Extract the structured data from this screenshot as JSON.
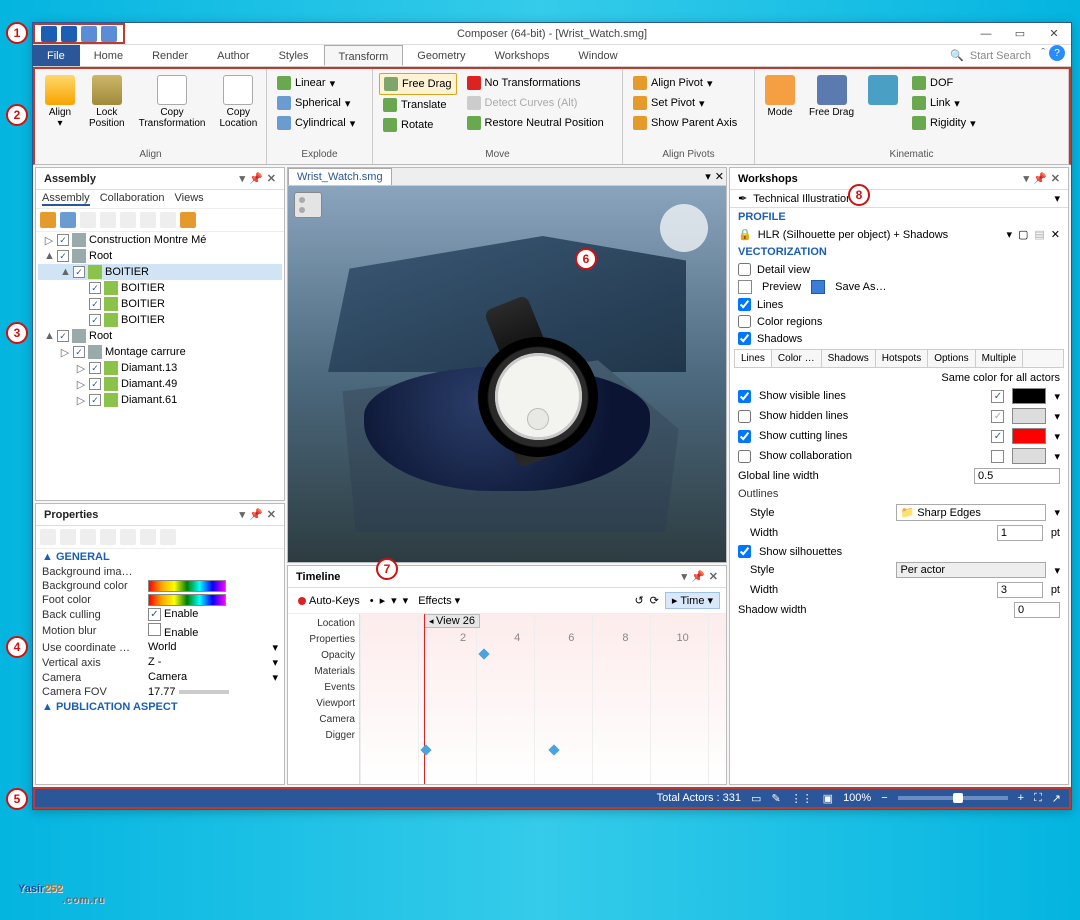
{
  "window_title": "Composer (64-bit) - [Wrist_Watch.smg]",
  "menu_tabs": [
    "File",
    "Home",
    "Render",
    "Author",
    "Styles",
    "Transform",
    "Geometry",
    "Workshops",
    "Window"
  ],
  "active_menu_tab": "Transform",
  "search_placeholder": "Start Search",
  "ribbon": {
    "align_group": "Align",
    "align_btn": "Align",
    "lock_btn": "Lock Position",
    "copy_trans": "Copy Transformation",
    "copy_loc": "Copy Location",
    "explode_group": "Explode",
    "explode_linear": "Linear",
    "explode_spherical": "Spherical",
    "explode_cyl": "Cylindrical",
    "move_group": "Move",
    "free_drag": "Free Drag",
    "translate": "Translate",
    "rotate": "Rotate",
    "no_trans": "No Transformations",
    "detect_curves": "Detect Curves (Alt)",
    "restore": "Restore Neutral Position",
    "pivots_group": "Align Pivots",
    "align_pivot": "Align Pivot",
    "set_pivot": "Set Pivot",
    "show_parent": "Show Parent Axis",
    "kine_group": "Kinematic",
    "mode": "Mode",
    "kine_free": "Free Drag",
    "dof": "DOF",
    "link": "Link",
    "rigidity": "Rigidity"
  },
  "assembly": {
    "title": "Assembly",
    "tabs": [
      "Assembly",
      "Collaboration",
      "Views"
    ],
    "tree": [
      {
        "indent": 0,
        "tw": "▷",
        "cb": true,
        "label": "Construction Montre Mé"
      },
      {
        "indent": 0,
        "tw": "▲",
        "cb": true,
        "label": "Root",
        "sel": false
      },
      {
        "indent": 1,
        "tw": "▲",
        "cb": true,
        "label": "BOITIER",
        "sel": true,
        "gear": true
      },
      {
        "indent": 2,
        "tw": "",
        "cb": true,
        "label": "BOITIER",
        "gear": true
      },
      {
        "indent": 2,
        "tw": "",
        "cb": true,
        "label": "BOITIER",
        "gear": true
      },
      {
        "indent": 2,
        "tw": "",
        "cb": true,
        "label": "BOITIER",
        "gear": true
      },
      {
        "indent": 0,
        "tw": "▲",
        "cb": true,
        "label": "Root"
      },
      {
        "indent": 1,
        "tw": "▷",
        "cb": true,
        "label": "Montage carrure"
      },
      {
        "indent": 2,
        "tw": "▷",
        "cb": true,
        "label": "Diamant.13",
        "gear": true
      },
      {
        "indent": 2,
        "tw": "▷",
        "cb": true,
        "label": "Diamant.49",
        "gear": true
      },
      {
        "indent": 2,
        "tw": "▷",
        "cb": true,
        "label": "Diamant.61",
        "gear": true
      }
    ]
  },
  "properties": {
    "title": "Properties",
    "section1": "GENERAL",
    "rows": [
      {
        "k": "Background ima…",
        "v": ""
      },
      {
        "k": "Background color",
        "v": "",
        "swatch": true
      },
      {
        "k": "Foot color",
        "v": "",
        "swatch": true
      },
      {
        "k": "Back culling",
        "v": "Enable",
        "check": true,
        "checked": true
      },
      {
        "k": "Motion blur",
        "v": "Enable",
        "check": true,
        "checked": false
      },
      {
        "k": "Use coordinate …",
        "v": "World",
        "dd": true
      },
      {
        "k": "Vertical axis",
        "v": "Z -",
        "dd": true
      },
      {
        "k": "Camera",
        "v": "Camera",
        "dd": true
      },
      {
        "k": "Camera FOV",
        "v": "17.77",
        "slider": true
      }
    ],
    "section2": "PUBLICATION ASPECT"
  },
  "viewport_tab": "Wrist_Watch.smg",
  "timeline": {
    "title": "Timeline",
    "auto_keys": "Auto-Keys",
    "effects": "Effects",
    "time": "Time",
    "view_marker": "View 26",
    "ticks": [
      "2",
      "4",
      "6",
      "8",
      "10"
    ],
    "tracks": [
      "Location",
      "Properties",
      "Opacity",
      "Materials",
      "Events",
      "Viewport",
      "Camera",
      "Digger"
    ]
  },
  "workshops": {
    "title": "Workshops",
    "subtitle": "Technical Illustration",
    "profile": "PROFILE",
    "profile_value": "HLR (Silhouette per object) + Shadows",
    "vector": "VECTORIZATION",
    "detail_view": "Detail view",
    "preview": "Preview",
    "saveas": "Save As…",
    "opt_lines": "Lines",
    "opt_color": "Color regions",
    "opt_shadows": "Shadows",
    "tabs": [
      "Lines",
      "Color …",
      "Shadows",
      "Hotspots",
      "Options",
      "Multiple"
    ],
    "same_color": "Same color for all actors",
    "show_visible": "Show visible lines",
    "show_hidden": "Show hidden lines",
    "show_cutting": "Show cutting lines",
    "show_collab": "Show collaboration",
    "glw": "Global line width",
    "glw_v": "0.5",
    "outlines": "Outlines",
    "style": "Style",
    "style_v": "Sharp Edges",
    "width": "Width",
    "width_v": "1",
    "pt": "pt",
    "show_sil": "Show silhouettes",
    "sil_style_v": "Per actor",
    "sil_width_v": "3",
    "shadow_w": "Shadow width",
    "shadow_w_v": "0"
  },
  "status": {
    "actors": "Total Actors : 331",
    "zoom": "100%"
  },
  "logo_name": "Yasir",
  "logo_num": "252",
  "logo_sub": ".com.ru",
  "callouts": [
    "1",
    "2",
    "3",
    "4",
    "5",
    "6",
    "7",
    "8"
  ]
}
